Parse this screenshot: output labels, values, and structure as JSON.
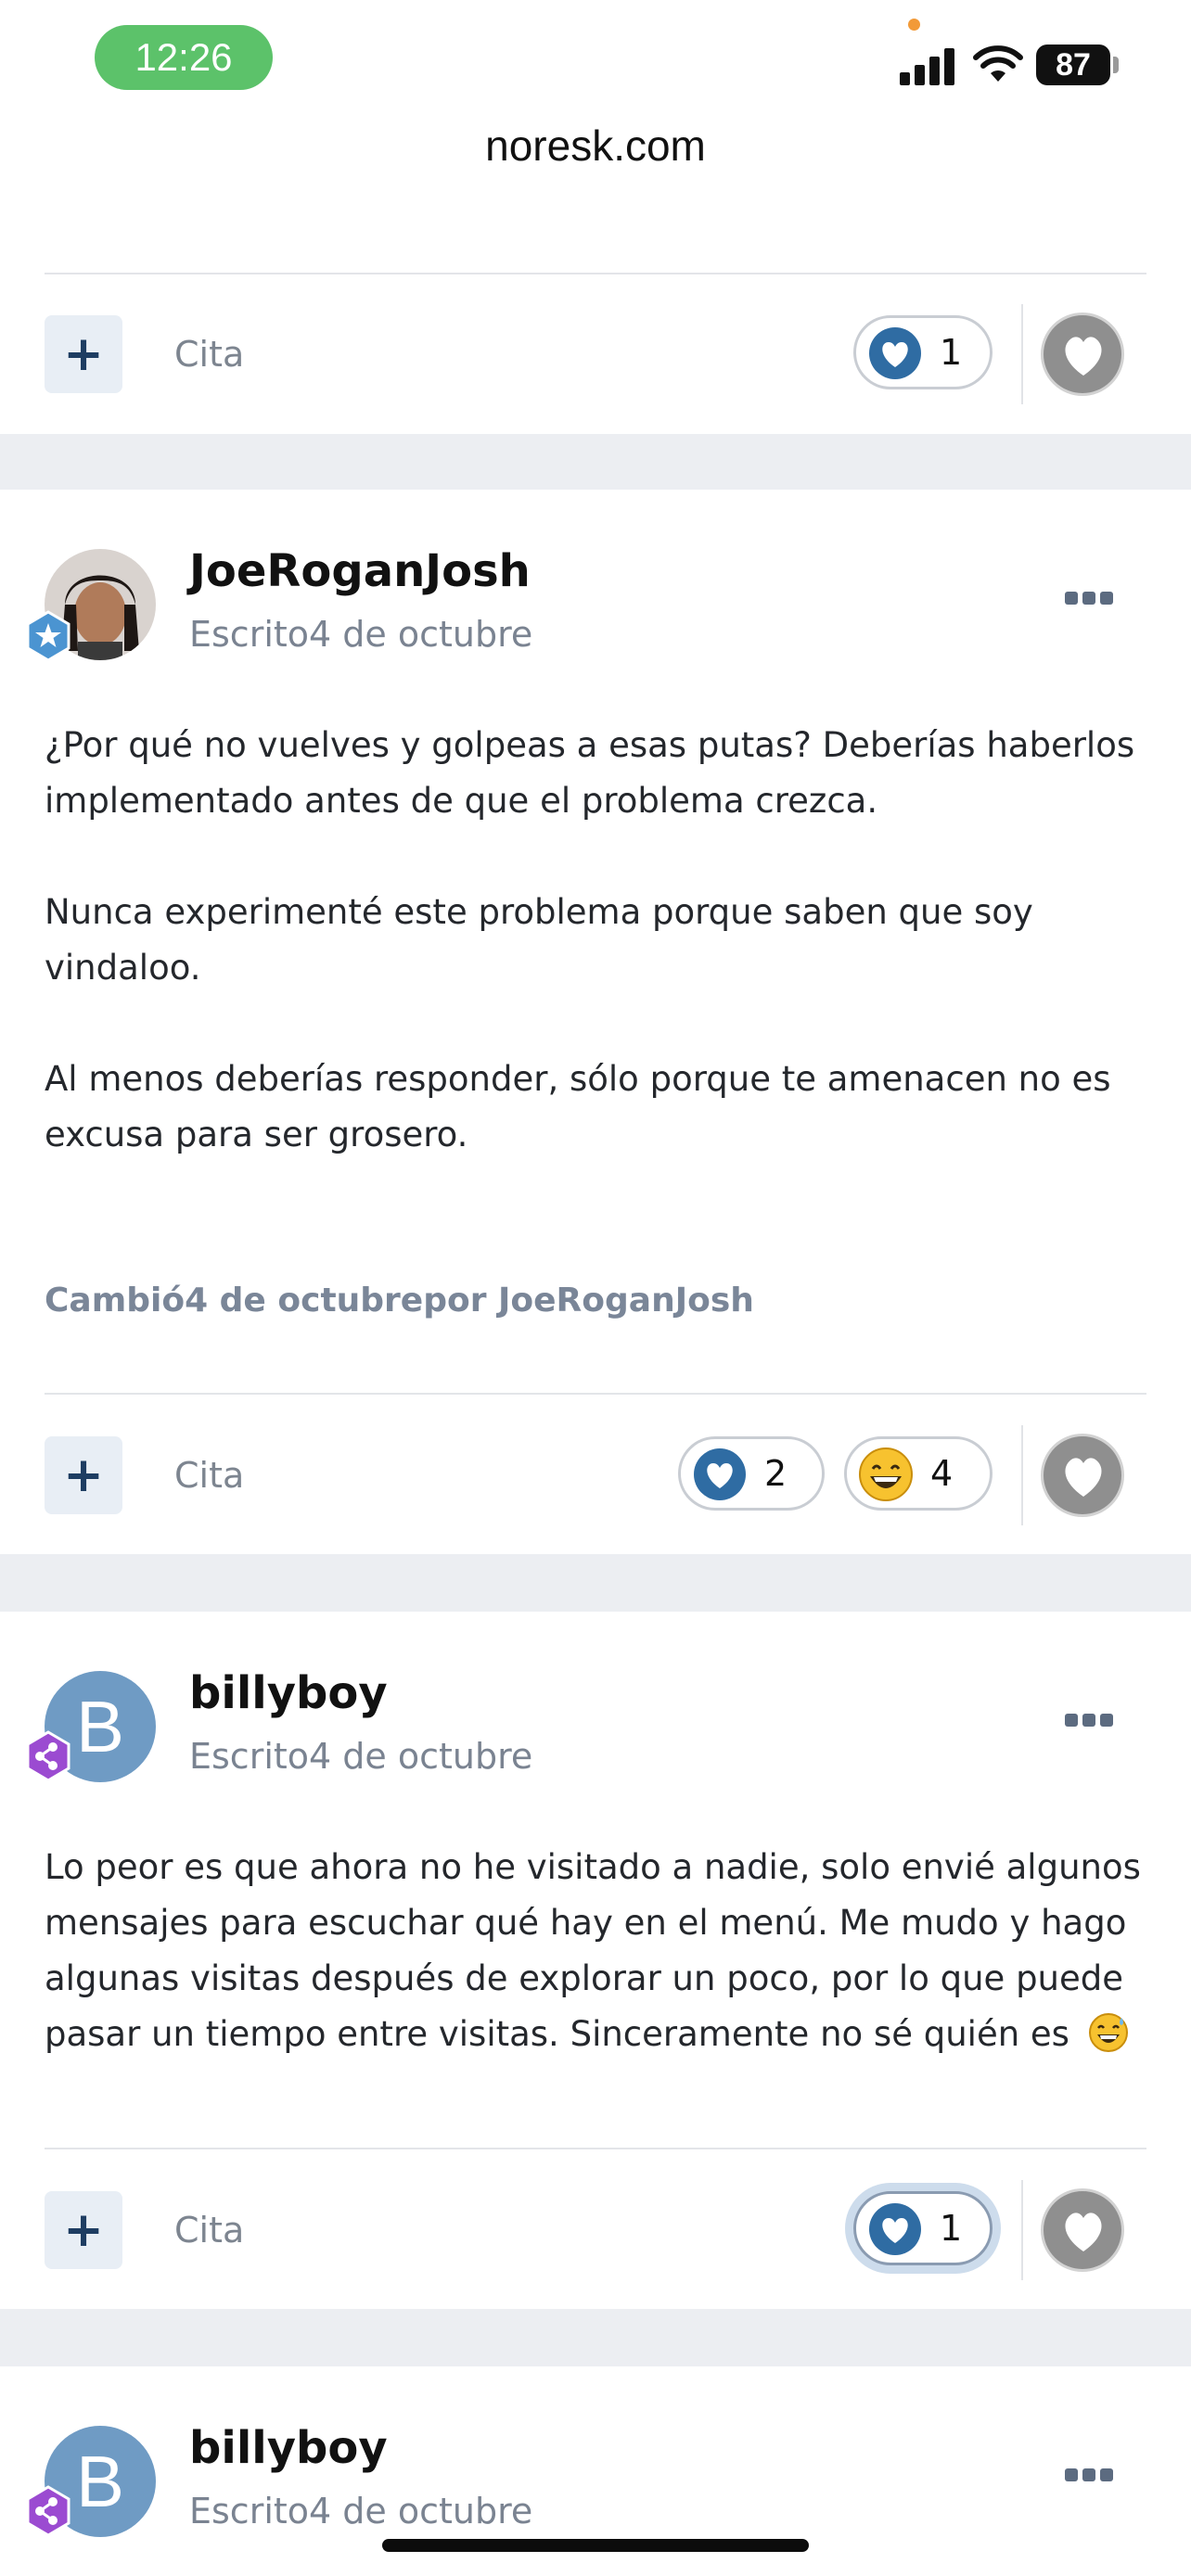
{
  "status_bar": {
    "time": "12:26",
    "battery": "87"
  },
  "browser": {
    "url": "noresk.com"
  },
  "colors": {
    "accent": "#5cc26a",
    "like_blue": "#2f6ca3",
    "badge_staff": "#4b94d1",
    "badge_member": "#9b4bd1"
  },
  "post_prev": {
    "quote_label": "Cita",
    "reactions": [
      {
        "icon": "heart-reaction-icon",
        "count": "1"
      }
    ]
  },
  "post_1": {
    "author": "JoeRoganJosh",
    "posted": "Escrito4 de octubre",
    "badge_icon": "star-badge-icon",
    "paragraphs": [
      "¿Por qué no vuelves y golpeas a esas putas? Deberías haberlos implementado antes de que el problema crezca.",
      "Nunca experimenté este problema porque saben que soy vindaloo.",
      "Al menos deberías responder, sólo porque te amenacen no es excusa para ser grosero."
    ],
    "edited": "Cambió4 de octubrepor JoeRoganJosh",
    "quote_label": "Cita",
    "reactions": [
      {
        "icon": "heart-reaction-icon",
        "count": "2"
      },
      {
        "icon": "grin-sweat-reaction-icon",
        "count": "4"
      }
    ]
  },
  "post_2": {
    "author": "billyboy",
    "avatar_letter": "B",
    "posted": "Escrito4 de octubre",
    "badge_icon": "share-badge-icon",
    "text": "Lo peor es que ahora no he visitado a nadie, solo envié algunos mensajes para escuchar qué hay en el menú. Me mudo y hago algunas visitas después de explorar un poco, por lo que puede pasar un tiempo entre visitas. Sinceramente no sé quién es",
    "quote_label": "Cita",
    "reactions": [
      {
        "icon": "heart-reaction-icon",
        "count": "1"
      }
    ]
  },
  "post_3": {
    "author": "billyboy",
    "avatar_letter": "B",
    "posted": "Escrito4 de octubre",
    "badge_icon": "share-badge-icon"
  }
}
